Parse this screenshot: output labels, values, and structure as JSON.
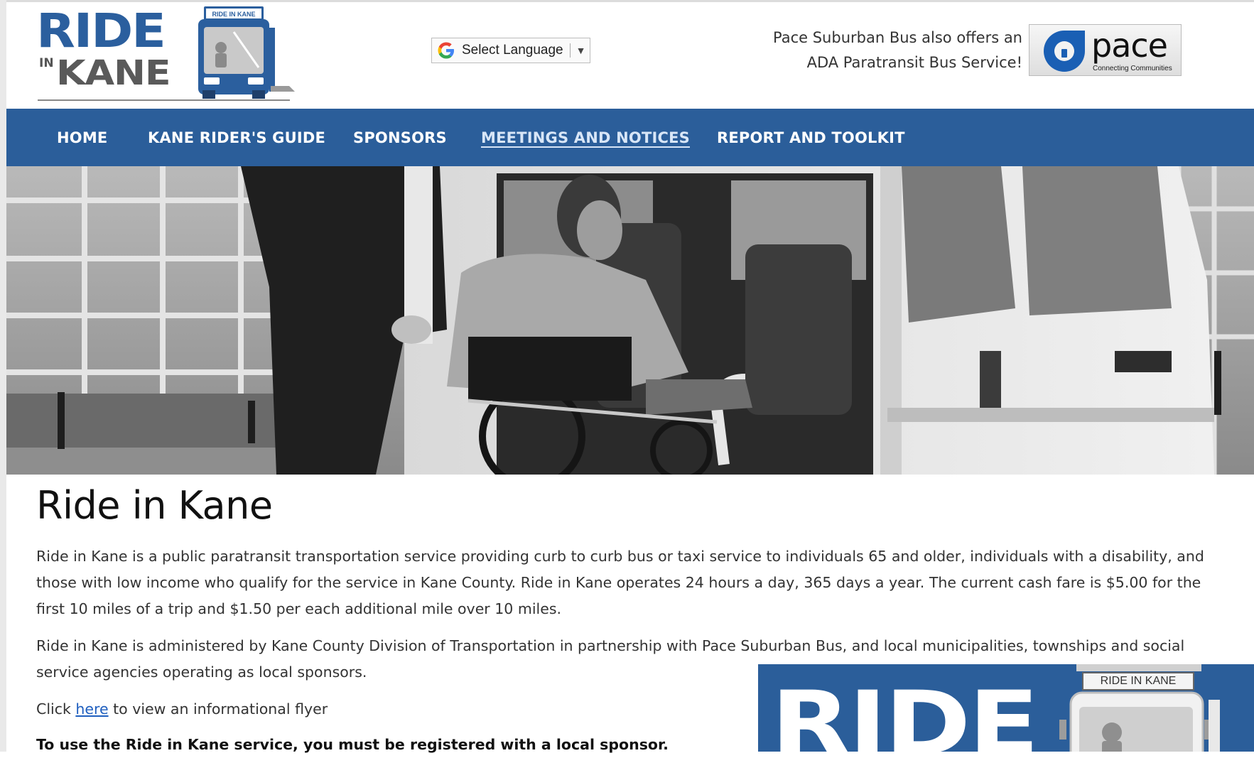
{
  "header": {
    "logo": {
      "name": "Ride in Kane",
      "ride": "RIDE",
      "in": "IN",
      "kane": "KANE",
      "bus_sign": "RIDE IN KANE"
    },
    "translate": {
      "label": "Select Language",
      "icon": "google-g-icon",
      "arrow": "▼"
    },
    "pace": {
      "line1": "Pace Suburban Bus also offers an",
      "line2": "ADA Paratransit Bus Service!",
      "logo_word": "pace",
      "logo_tagline": "Connecting Communities"
    }
  },
  "nav": {
    "items": [
      {
        "label": "HOME",
        "active": false
      },
      {
        "label": "KANE RIDER'S GUIDE",
        "active": false
      },
      {
        "label": "SPONSORS",
        "active": false
      },
      {
        "label": "MEETINGS AND NOTICES",
        "active": true
      },
      {
        "label": "REPORT AND TOOLKIT",
        "active": false
      }
    ]
  },
  "hero": {
    "alt": "Man in a wheelchair being assisted into a paratransit van"
  },
  "main": {
    "title": "Ride in Kane",
    "paragraph1": "Ride in Kane is a public paratransit transportation service providing curb to curb bus or taxi service to individuals 65 and older, individuals with a disability, and those with low income who qualify for the  service in Kane County. Ride in Kane operates 24 hours a day, 365 days a year. The current cash fare is $5.00 for the first 10 miles of a trip and $1.50 per each additional mile over 10 miles.",
    "paragraph2": "Ride in Kane is administered by Kane County Division of Transportation in partnership with Pace Suburban Bus, and local municipalities, townships and social service agencies operating as local sponsors.",
    "flyer_prefix": "Click ",
    "flyer_link": "here",
    "flyer_suffix": " to view an informational flyer",
    "registration_note": "To use the Ride in Kane service, you must be registered with a local sponsor."
  },
  "banner": {
    "big_text": "RIDE",
    "bus_label": "RIDE IN KANE"
  },
  "colors": {
    "brand_blue": "#2b5e9a",
    "logo_blue": "#2b5f9e",
    "link_blue": "#1f5fbf",
    "text": "#333333"
  }
}
